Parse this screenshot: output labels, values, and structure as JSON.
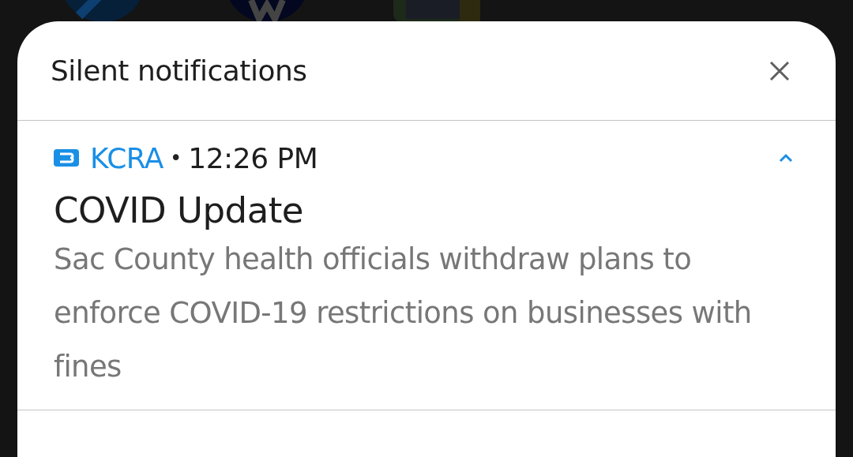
{
  "panel": {
    "title": "Silent notifications"
  },
  "notifications": [
    {
      "app": "KCRA",
      "time": "12:26 PM",
      "separator": "•",
      "expanded": true,
      "title": "COVID Update",
      "body": "Sac County health officials withdraw plans to enforce COVID-19 restrictions on businesses with fines"
    }
  ]
}
